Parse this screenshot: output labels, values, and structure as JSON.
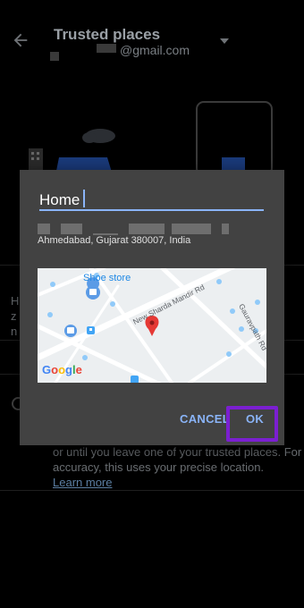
{
  "header": {
    "title": "Trusted places",
    "account_email": "@gmail.com"
  },
  "background": {
    "info_line1": "or until you leave one of your trusted places. For",
    "info_line2": "accuracy, this uses your precise location.",
    "learn_more": "Learn more"
  },
  "dialog": {
    "name_value": "Home",
    "address": "Ahmedabad, Gujarat 380007, India",
    "map": {
      "poi_label": "Shoe store",
      "road_label_1": "New Sharda Mandir Rd",
      "road_label_2": "Gauravpath Rd",
      "logo_text": "Google"
    },
    "cancel_label": "CANCEL",
    "ok_label": "OK",
    "accent_color": "#8ab4f8",
    "highlight_color": "#7b1fd1"
  }
}
